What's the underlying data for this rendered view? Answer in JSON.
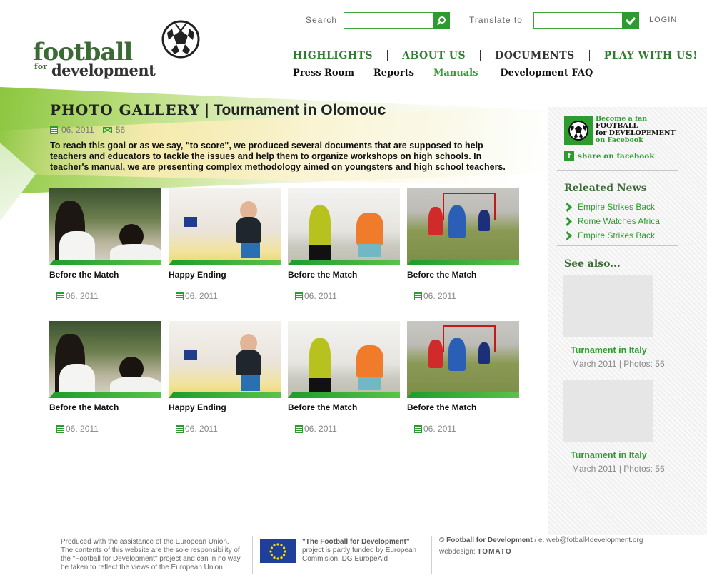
{
  "header": {
    "logo": {
      "main": "football",
      "for": "for",
      "dev": "development"
    },
    "search": {
      "label": "Search",
      "value": ""
    },
    "translate": {
      "label": "Translate to",
      "value": ""
    },
    "login": "LOGIN"
  },
  "nav": {
    "main": [
      {
        "label": "HIGHLIGHTS",
        "color": "#2e7d32"
      },
      {
        "label": "ABOUT US",
        "color": "#2e7d32"
      },
      {
        "label": "DOCUMENTS",
        "color": "#333333"
      },
      {
        "label": "PLAY WITH US!",
        "color": "#2e7d32"
      }
    ],
    "sub": [
      {
        "label": "Press Room",
        "color": "#111111"
      },
      {
        "label": "Reports",
        "color": "#111111"
      },
      {
        "label": "Manuals",
        "color": "#2e9b2e"
      },
      {
        "label": "Development FAQ",
        "color": "#111111"
      }
    ]
  },
  "page": {
    "section": "PHOTO GALLERY",
    "separator": "|",
    "title": "Tournament in Olomouc",
    "date": "06. 2011",
    "count": "56",
    "intro": "To reach this goal or as we say, \"to score\", we produced several documents that are supposed to help teachers and educators to tackle the issues and help them to organize workshops on high schools. In teacher's manual, we are presenting complex methodology aimed on youngsters and high school teachers."
  },
  "gallery": [
    {
      "caption": "Before the Match",
      "date": "06. 2011",
      "scene": "girls"
    },
    {
      "caption": "Happy Ending",
      "date": "06. 2011",
      "scene": "goal"
    },
    {
      "caption": "Before the Match",
      "date": "06. 2011",
      "scene": "ref"
    },
    {
      "caption": "Before the Match",
      "date": "06. 2011",
      "scene": "field"
    },
    {
      "caption": "Before the Match",
      "date": "06. 2011",
      "scene": "girls"
    },
    {
      "caption": "Happy Ending",
      "date": "06. 2011",
      "scene": "goal"
    },
    {
      "caption": "Before the Match",
      "date": "06. 2011",
      "scene": "ref"
    },
    {
      "caption": "Before the Match",
      "date": "06. 2011",
      "scene": "field"
    }
  ],
  "sidebar": {
    "facebook": {
      "line1": "Become a fan",
      "line2": "FOOTBALL",
      "line3": "for DEVELOPEMENT",
      "line4": "on Facebook",
      "share": "share on facebook"
    },
    "news_heading": "Releated News",
    "news": [
      "Empire Strikes Back",
      "Rome Watches Africa",
      "Empire Strikes Back"
    ],
    "see_heading": "See also...",
    "see_also": [
      {
        "title": "Turnament in Italy",
        "meta": "March 2011 | Photos: 56"
      },
      {
        "title": "Turnament in Italy",
        "meta": "March 2011 | Photos: 56"
      }
    ]
  },
  "footer": {
    "disclaimer": "Produced with the assistance of the European Union. The contents of this website are the sole responsibility of the \"Football for Development\" project and can in no way be taken to reflect the views of the European Union.",
    "funded_title": "\"The Football for Development\"",
    "funded_text": "project is partly funded by European Commision, DG EuropeAid",
    "copyright": "© Football for Development",
    "email": " / e. web@fotball4development.org",
    "webdesign_label": "webdesign:",
    "webdesign_name": "TOMATO"
  },
  "colors": {
    "accent": "#2e9b2e",
    "brand_dark": "#3b6b34"
  }
}
